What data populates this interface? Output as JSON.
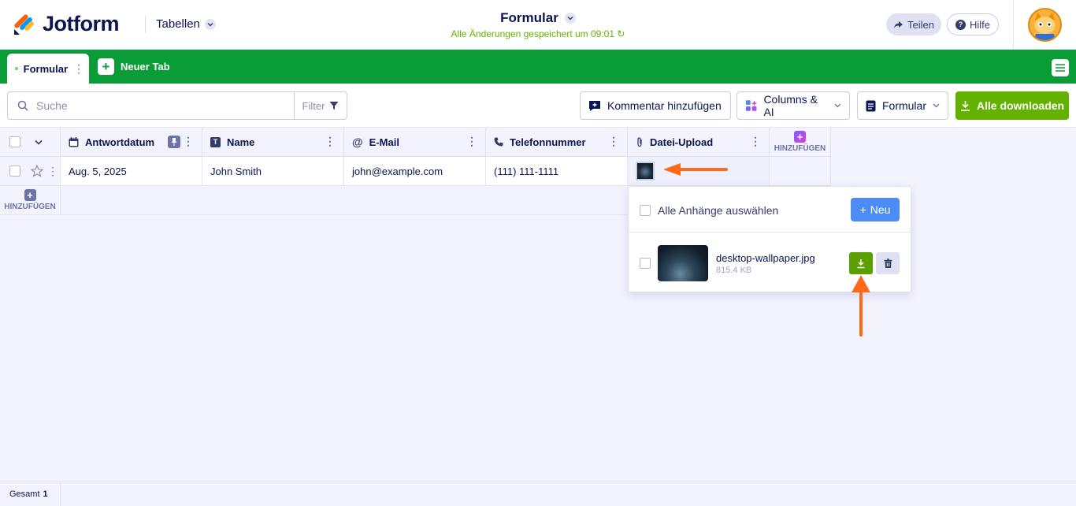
{
  "header": {
    "brand": "Jotform",
    "tables_label": "Tabellen",
    "title": "Formular",
    "saved_status": "Alle Änderungen gespeichert um 09:01",
    "share_label": "Teilen",
    "help_label": "Hilfe"
  },
  "tabs": {
    "active_label": "Formular",
    "new_tab_label": "Neuer Tab"
  },
  "toolbar": {
    "search_placeholder": "Suche",
    "filter_label": "Filter",
    "comment_label": "Kommentar hinzufügen",
    "columns_ai_label": "Columns & AI",
    "form_label": "Formular",
    "download_all_label": "Alle downloaden"
  },
  "table": {
    "columns": [
      {
        "label": "Antwortdatum",
        "icon": "calendar-icon"
      },
      {
        "label": "Name",
        "icon": "text-icon"
      },
      {
        "label": "E-Mail",
        "icon": "at-icon"
      },
      {
        "label": "Telefonnummer",
        "icon": "phone-icon"
      },
      {
        "label": "Datei-Upload",
        "icon": "paperclip-icon"
      }
    ],
    "add_column_label": "HINZUFÜGEN",
    "add_row_label": "HINZUFÜGEN",
    "rows": [
      {
        "date": "Aug. 5, 2025",
        "name": "John Smith",
        "email": "john@example.com",
        "phone": "(111) 111-1111"
      }
    ]
  },
  "attachments": {
    "select_all_label": "Alle Anhänge auswählen",
    "new_label": "Neu",
    "files": [
      {
        "name": "desktop-wallpaper.jpg",
        "size": "815.4 KB"
      }
    ]
  },
  "footer": {
    "total_label": "Gesamt",
    "total_count": "1"
  },
  "colors": {
    "brand_green": "#0a9d37",
    "download_green": "#64b200",
    "accent_blue": "#4d8cf5",
    "annotation_orange": "#ff6a1a",
    "navy": "#0a1551"
  }
}
